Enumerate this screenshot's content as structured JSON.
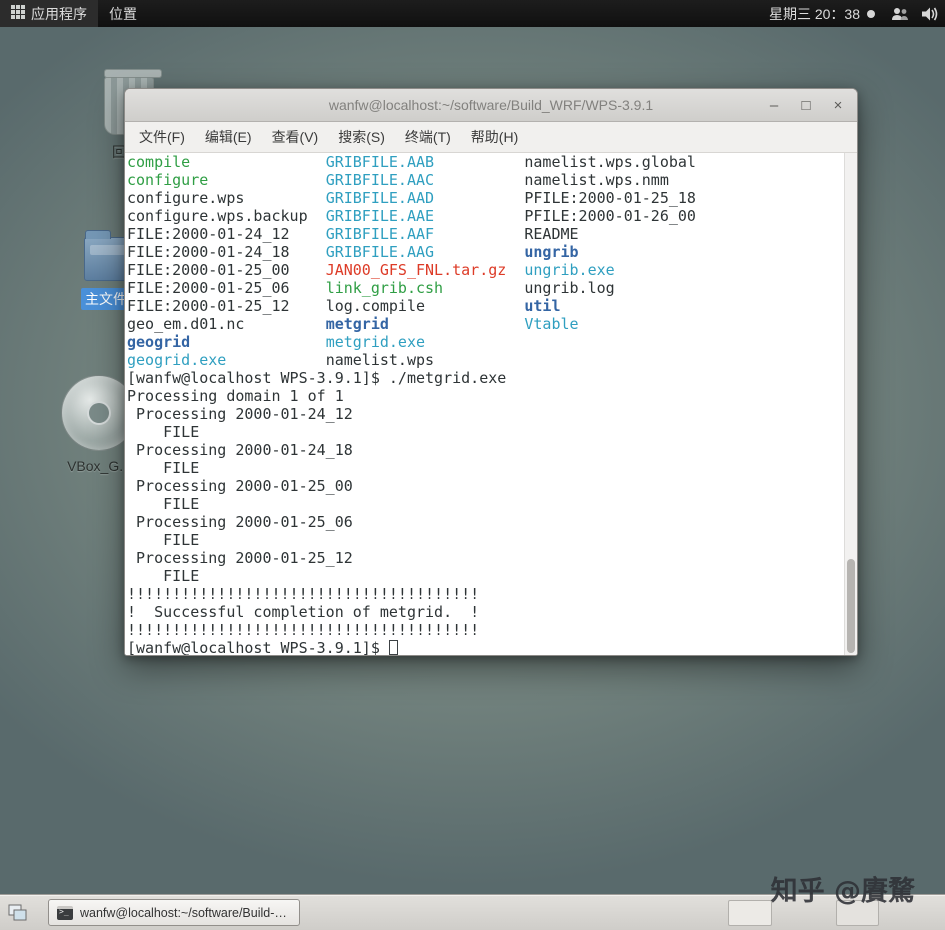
{
  "panel": {
    "applications": "应用程序",
    "places": "位置",
    "clock": "星期三 20：38"
  },
  "desktop": {
    "icons": [
      {
        "id": "trash",
        "label": "回收站"
      },
      {
        "id": "home",
        "label": "主文件夹"
      },
      {
        "id": "vbox-cd",
        "label": "VBox_G..."
      }
    ],
    "watermark": "知乎 @賡騖"
  },
  "window": {
    "title": "wanfw@localhost:~/software/Build_WRF/WPS-3.9.1",
    "controls": {
      "minimize": "–",
      "maximize": "□",
      "close": "×"
    },
    "menu": [
      "文件(F)",
      "编辑(E)",
      "查看(V)",
      "搜索(S)",
      "终端(T)",
      "帮助(H)"
    ]
  },
  "terminal": {
    "palette": {
      "foreground": "#2e3436",
      "green": "#2f9e44",
      "blue": "#3465a4",
      "cyan": "#2f9fc0",
      "red": "#dd3b27",
      "background": "#ffffff"
    },
    "lines": [
      [
        [
          "compile               ",
          "g"
        ],
        [
          "GRIBFILE.AAB          ",
          "c"
        ],
        [
          "namelist.wps.global",
          "k"
        ]
      ],
      [
        [
          "configure             ",
          "g"
        ],
        [
          "GRIBFILE.AAC          ",
          "c"
        ],
        [
          "namelist.wps.nmm",
          "k"
        ]
      ],
      [
        [
          "configure.wps         ",
          "k"
        ],
        [
          "GRIBFILE.AAD          ",
          "c"
        ],
        [
          "PFILE:2000-01-25_18",
          "k"
        ]
      ],
      [
        [
          "configure.wps.backup  ",
          "k"
        ],
        [
          "GRIBFILE.AAE          ",
          "c"
        ],
        [
          "PFILE:2000-01-26_00",
          "k"
        ]
      ],
      [
        [
          "FILE:2000-01-24_12    ",
          "k"
        ],
        [
          "GRIBFILE.AAF          ",
          "c"
        ],
        [
          "README",
          "k"
        ]
      ],
      [
        [
          "FILE:2000-01-24_18    ",
          "k"
        ],
        [
          "GRIBFILE.AAG          ",
          "c"
        ],
        [
          "ungrib",
          "b"
        ]
      ],
      [
        [
          "FILE:2000-01-25_00    ",
          "k"
        ],
        [
          "JAN00_GFS_FNL.tar.gz  ",
          "r"
        ],
        [
          "ungrib.exe",
          "c"
        ]
      ],
      [
        [
          "FILE:2000-01-25_06    ",
          "k"
        ],
        [
          "link_grib.csh         ",
          "g"
        ],
        [
          "ungrib.log",
          "k"
        ]
      ],
      [
        [
          "FILE:2000-01-25_12    ",
          "k"
        ],
        [
          "log.compile           ",
          "k"
        ],
        [
          "util",
          "b"
        ]
      ],
      [
        [
          "geo_em.d01.nc         ",
          "k"
        ],
        [
          "metgrid               ",
          "b"
        ],
        [
          "Vtable",
          "c"
        ]
      ],
      [
        [
          "geogrid               ",
          "b"
        ],
        [
          "metgrid.exe",
          "c"
        ]
      ],
      [
        [
          "geogrid.exe           ",
          "c"
        ],
        [
          "namelist.wps",
          "k"
        ]
      ],
      [
        [
          "[wanfw@localhost WPS-3.9.1]$ ./metgrid.exe",
          "k"
        ]
      ],
      [
        [
          "Processing domain 1 of 1",
          "k"
        ]
      ],
      [
        [
          " Processing 2000-01-24_12",
          "k"
        ]
      ],
      [
        [
          "    FILE",
          "k"
        ]
      ],
      [
        [
          " Processing 2000-01-24_18",
          "k"
        ]
      ],
      [
        [
          "    FILE",
          "k"
        ]
      ],
      [
        [
          " Processing 2000-01-25_00",
          "k"
        ]
      ],
      [
        [
          "    FILE",
          "k"
        ]
      ],
      [
        [
          " Processing 2000-01-25_06",
          "k"
        ]
      ],
      [
        [
          "    FILE",
          "k"
        ]
      ],
      [
        [
          " Processing 2000-01-25_12",
          "k"
        ]
      ],
      [
        [
          "    FILE",
          "k"
        ]
      ],
      [
        [
          "!!!!!!!!!!!!!!!!!!!!!!!!!!!!!!!!!!!!!!!",
          "k"
        ]
      ],
      [
        [
          "!  Successful completion of metgrid.  !",
          "k"
        ]
      ],
      [
        [
          "!!!!!!!!!!!!!!!!!!!!!!!!!!!!!!!!!!!!!!!",
          "k"
        ]
      ],
      [
        [
          "[wanfw@localhost WPS-3.9.1]$ ",
          "k"
        ]
      ]
    ]
  },
  "taskbar": {
    "task": "wanfw@localhost:~/software/Build-…"
  }
}
